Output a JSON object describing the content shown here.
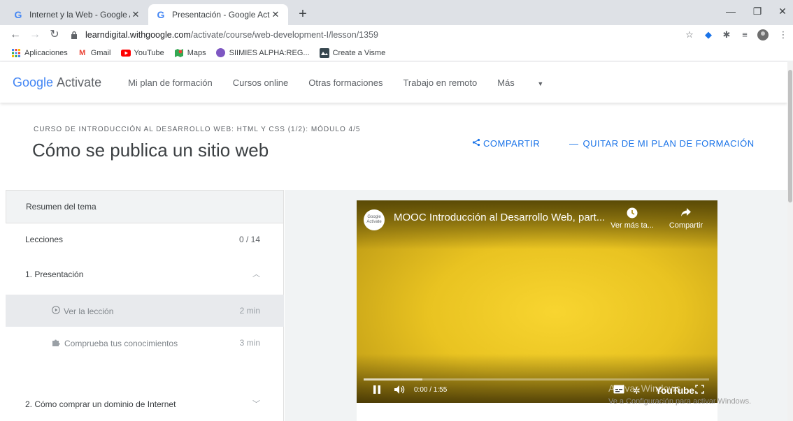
{
  "browser": {
    "tabs": [
      {
        "title": "Internet y la Web - Google Activa",
        "close": "✕"
      },
      {
        "title": "Presentación - Google Activate",
        "close": "✕"
      }
    ],
    "new_tab": "+",
    "url_host": "learndigital.withgoogle.com",
    "url_path": "/activate/course/web-development-I/lesson/1359",
    "bookmarks": [
      {
        "label": "Aplicaciones",
        "icon": "apps-grid-icon"
      },
      {
        "label": "Gmail",
        "icon": "gmail-icon"
      },
      {
        "label": "YouTube",
        "icon": "youtube-icon"
      },
      {
        "label": "Maps",
        "icon": "maps-icon"
      },
      {
        "label": "SIIMIES ALPHA:REG...",
        "icon": "circle-bookmark-icon"
      },
      {
        "label": "Create a Visme",
        "icon": "visme-icon"
      }
    ]
  },
  "site": {
    "logo_google": "Google",
    "logo_product": "Activate",
    "nav": [
      "Mi plan de formación",
      "Cursos online",
      "Otras formaciones",
      "Trabajo en remoto",
      "Más"
    ]
  },
  "lesson": {
    "breadcrumb": "CURSO DE INTRODUCCIÓN AL DESARROLLO WEB: HTML Y CSS (1/2): MÓDULO 4/5",
    "title": "Cómo se publica un sitio web",
    "share": "COMPARTIR",
    "remove": "QUITAR DE MI PLAN DE FORMACIÓN"
  },
  "sidebar": {
    "summary": "Resumen del tema",
    "lessons_label": "Lecciones",
    "lessons_count": "0 / 14",
    "section1": "1. Presentación",
    "item1_label": "Ver la lección",
    "item1_dur": "2 min",
    "item2_label": "Comprueba tus conocimientos",
    "item2_dur": "3 min",
    "section2": "2. Cómo comprar un dominio de Internet"
  },
  "video": {
    "channel_avatar": "Google Activate",
    "title": "MOOC Introducción al Desarrollo Web, part...",
    "watch_later": "Ver más ta...",
    "share": "Compartir",
    "time": "0:00 / 1:55",
    "youtube_label": "YouTube",
    "progress_loaded": 0.17,
    "colors": {
      "yellow": "#f8d530"
    }
  },
  "watermark": {
    "line1": "Activar Windows",
    "line2": "Ve a Configuración para activar Windows."
  }
}
